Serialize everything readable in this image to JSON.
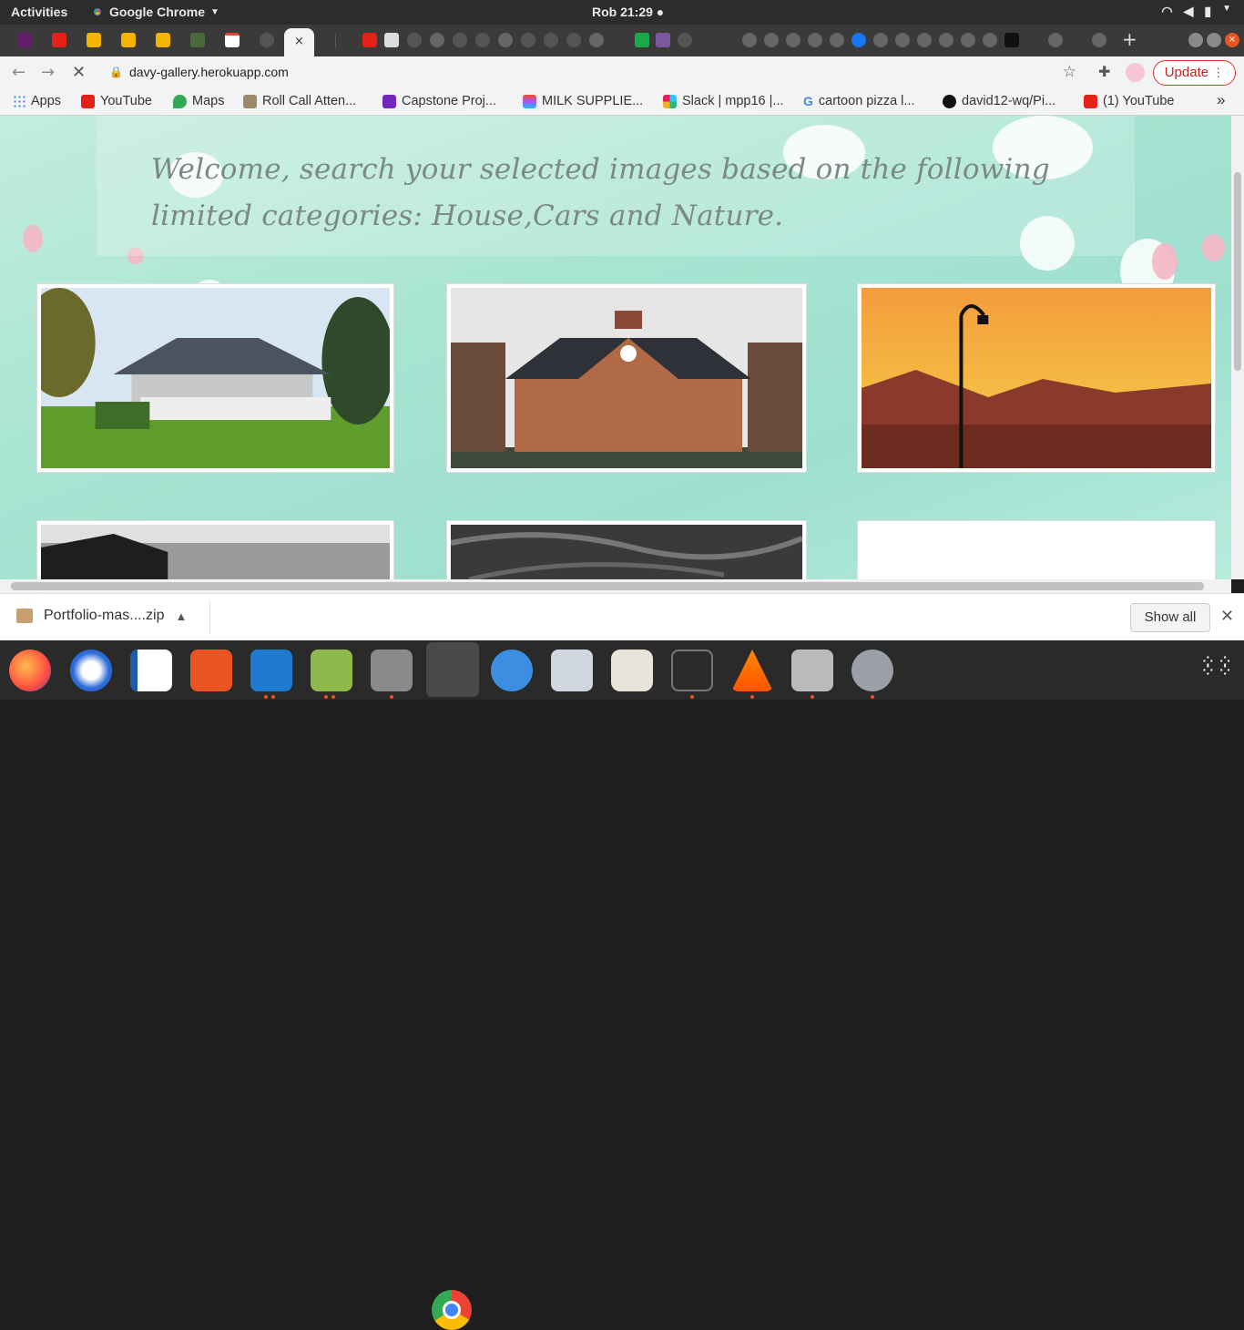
{
  "system": {
    "activities": "Activities",
    "app_name": "Google Chrome",
    "clock": "Rob 21:29 ●"
  },
  "browser": {
    "active_tab_close": "×",
    "new_tab": "+",
    "url": "davy-gallery.herokuapp.com",
    "update_label": "Update"
  },
  "bookmarks": {
    "apps": "Apps",
    "items": [
      "YouTube",
      "Maps",
      "Roll Call Atten...",
      "Capstone Proj...",
      "MILK SUPPLIE...",
      "Slack | mpp16 |...",
      "cartoon pizza l...",
      "david12-wq/Pi...",
      "(1) YouTube"
    ],
    "more": "»"
  },
  "page": {
    "welcome": "Welcome, search your selected images based on the following limited categories: House,Cars and Nature."
  },
  "download": {
    "filename": "Portfolio-mas....zip",
    "show_all": "Show all"
  },
  "colors": {
    "accent_update": "#d93025",
    "page_bg": "#a8e4d2",
    "dock_indicator": "#e95420"
  }
}
